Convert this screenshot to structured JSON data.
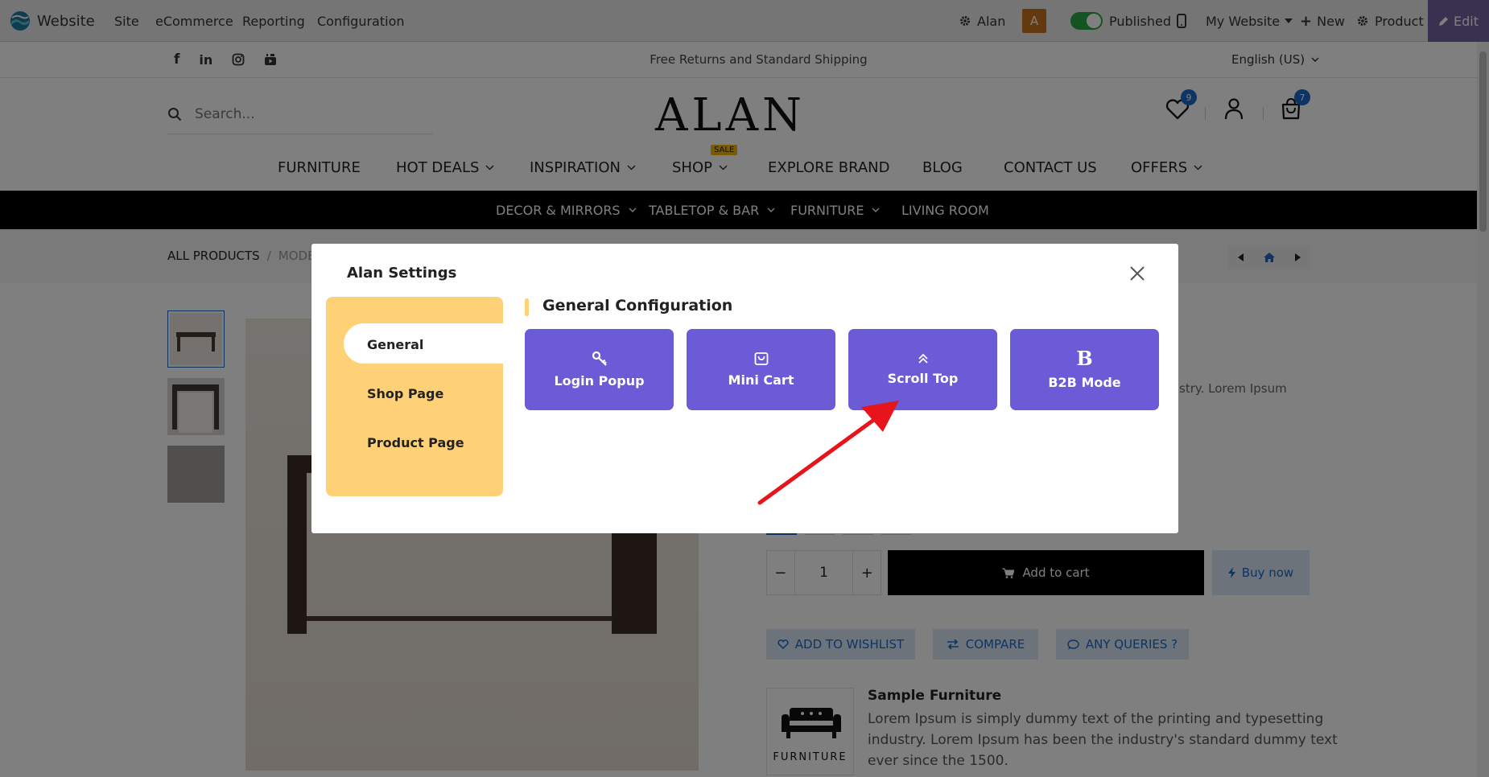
{
  "topbar": {
    "app_name": "Website",
    "menu": [
      "Site",
      "eCommerce",
      "Reporting",
      "Configuration"
    ],
    "user_name": "Alan",
    "user_initial": "A",
    "published_label": "Published",
    "website_selector": "My Website",
    "new_label": "New",
    "product_label": "Product",
    "edit_label": "Edit"
  },
  "announce": {
    "text": "Free Returns and Standard Shipping",
    "language": "English (US)"
  },
  "header": {
    "search_placeholder": "Search...",
    "logo": "ALAN",
    "wishlist_count": "9",
    "cart_count": "7"
  },
  "main_menu": [
    "FURNITURE",
    "HOT DEALS",
    "INSPIRATION",
    "SHOP",
    "EXPLORE BRAND",
    "BLOG",
    "CONTACT US",
    "OFFERS"
  ],
  "sale_badge": "SALE",
  "categories": [
    "DECOR & MIRRORS",
    "TABLETOP & BAR",
    "FURNITURE",
    "LIVING ROOM"
  ],
  "breadcrumb": {
    "root": "ALL PRODUCTS",
    "separator": "/",
    "current": "MODE"
  },
  "product": {
    "desc_fragment": "stry. Lorem Ipsum",
    "quantity": "1",
    "qty_minus": "−",
    "qty_plus": "+",
    "add_to_cart": "Add to cart",
    "buy_now": "Buy now",
    "wishlist": "ADD TO WISHLIST",
    "compare": "COMPARE",
    "queries": "ANY QUERIES ?",
    "brand_logo_text": "FURNITURE",
    "brand_title": "Sample Furniture",
    "brand_desc": [
      "Lorem Ipsum is simply dummy text of the printing and typesetting",
      "industry. Lorem Ipsum has been the industry's standard dummy text",
      "ever since the 1500."
    ]
  },
  "modal": {
    "title": "Alan Settings",
    "sidebar": [
      "General",
      "Shop Page",
      "Product Page"
    ],
    "active_item": "General",
    "section_title": "General Configuration",
    "buttons": [
      {
        "label": "Login Popup",
        "icon": "key-icon"
      },
      {
        "label": "Mini Cart",
        "icon": "shopping-bag-icon"
      },
      {
        "label": "Scroll Top",
        "icon": "double-chevron-up-icon"
      },
      {
        "label": "B2B Mode",
        "icon": "bold-b-icon"
      }
    ],
    "b2b_glyph": "B"
  },
  "colors": {
    "odoo_purple": "#71639e",
    "accent_purple": "#6b5bd6",
    "sidebar_yellow": "#ffd177",
    "arrow_red": "#e8141c",
    "category_bar": "#000000",
    "link_blue": "#1a68c7"
  }
}
